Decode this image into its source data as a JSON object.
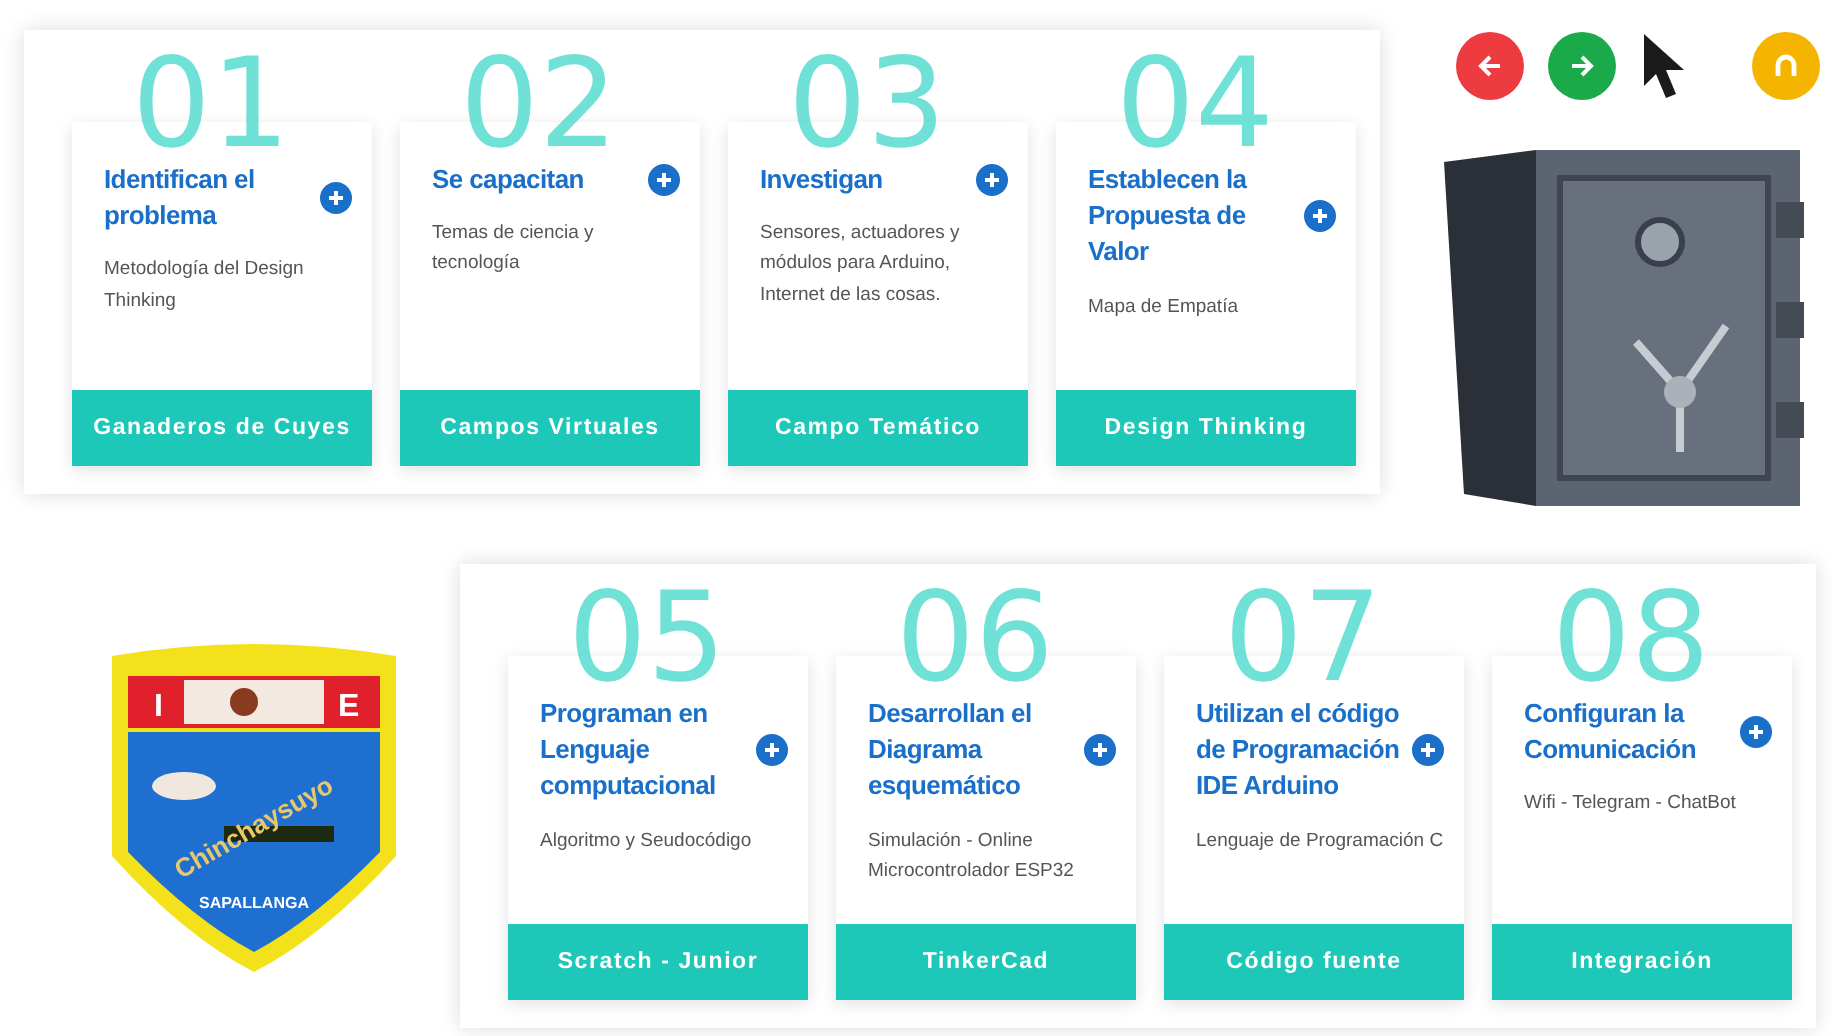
{
  "nav_buttons": [
    {
      "kind": "back",
      "color": "#ee3b3f"
    },
    {
      "kind": "forward",
      "color": "#1aaa4a"
    },
    {
      "kind": "home",
      "color": "#f5b400"
    }
  ],
  "panels": [
    {
      "steps": [
        {
          "number": "01",
          "title": "Identifican el problema",
          "description": "Metodología del Design Thinking",
          "button": "Ganaderos de Cuyes"
        },
        {
          "number": "02",
          "title": "Se capacitan",
          "description": "Temas de ciencia y tecnología",
          "button": "Campos Virtuales"
        },
        {
          "number": "03",
          "title": "Investigan",
          "description": "Sensores, actuadores y módulos para Arduino, Internet de las cosas.",
          "button": "Campo Temático"
        },
        {
          "number": "04",
          "title": "Establecen la Propuesta de Valor",
          "description": "Mapa de Empatía",
          "button": "Design Thinking"
        }
      ]
    },
    {
      "steps": [
        {
          "number": "05",
          "title": "Programan en Lenguaje computacional",
          "description": "Algoritmo y Seudocódigo",
          "button": "Scratch - Junior"
        },
        {
          "number": "06",
          "title": "Desarrollan el Diagrama esquemático",
          "description": "Simulación - Online Microcontrolador ESP32",
          "button": "TinkerCad"
        },
        {
          "number": "07",
          "title": "Utilizan el código de Programación IDE Arduino",
          "description": "Lenguaje de Programación C",
          "button": "Código fuente"
        },
        {
          "number": "08",
          "title": "Configuran la Comunicación",
          "description": "Wifi - Telegram - ChatBot",
          "button": "Integración"
        }
      ]
    }
  ],
  "logo": {
    "letters": [
      "I",
      "E"
    ],
    "motto": "Chinchaysuyo",
    "place": "SAPALLANGA"
  }
}
